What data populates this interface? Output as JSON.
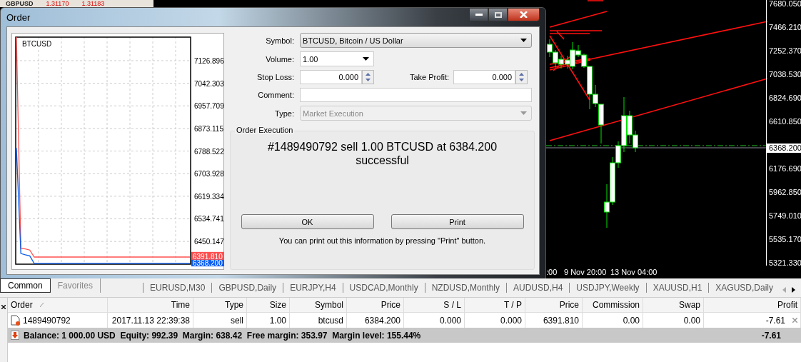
{
  "market_watch": {
    "symbol": "GBPUSD",
    "bid": "1.31170",
    "ask": "1.31183"
  },
  "window": {
    "title": "Order"
  },
  "tick_chart": {
    "chart_data": {
      "type": "line",
      "title": "BTCUSD",
      "grid": true,
      "categories": [
        null,
        null,
        null,
        null,
        null,
        null,
        null,
        null,
        null,
        null,
        null,
        null,
        null,
        null,
        null,
        null,
        null,
        null,
        null,
        null,
        null,
        null,
        null,
        null,
        null,
        null,
        null,
        null,
        null,
        null,
        null,
        null,
        null,
        null,
        null,
        null,
        null,
        null,
        null,
        null
      ],
      "ylim": [
        6365,
        7215
      ],
      "yticks": [
        {
          "value": 6450.147,
          "label": "6450.147"
        },
        {
          "value": 6534.741,
          "label": "6534.741"
        },
        {
          "value": 6619.334,
          "label": "6619.334"
        },
        {
          "value": 6703.928,
          "label": "6703.928"
        },
        {
          "value": 6788.522,
          "label": "6788.522"
        },
        {
          "value": 6873.115,
          "label": "6873.115"
        },
        {
          "value": 6957.709,
          "label": "6957.709"
        },
        {
          "value": 7042.303,
          "label": "7042.303"
        },
        {
          "value": 7126.896,
          "label": "7126.896"
        }
      ],
      "series": [
        {
          "color": "#ff5050",
          "values": [
            7215,
            6425,
            6422,
            6418,
            6391.81,
            6391.81,
            6391.81,
            6391.81,
            6391.81,
            6391.81,
            6391.81,
            6391.81,
            6391.81,
            6391.81,
            6391.81,
            6391.81,
            6391.81,
            6391.81,
            6391.81,
            6391.81,
            6391.81,
            6391.81,
            6391.81,
            6391.81,
            6391.81,
            6391.81,
            6391.81,
            6391.81,
            6391.81,
            6391.81,
            6391.81,
            6391.81,
            6391.81,
            6391.81,
            6391.81,
            6391.81,
            6391.81,
            6391.81,
            6391.81,
            6391.81
          ]
        },
        {
          "color": "#0a5cf0",
          "values": [
            6800,
            6405,
            6400,
            6396,
            6368.2,
            6368.2,
            6368.2,
            6368.2,
            6368.2,
            6368.2,
            6368.2,
            6368.2,
            6368.2,
            6368.2,
            6368.2,
            6368.2,
            6368.2,
            6368.2,
            6368.2,
            6368.2,
            6368.2,
            6368.2,
            6368.2,
            6368.2,
            6368.2,
            6368.2,
            6368.2,
            6368.2,
            6368.2,
            6368.2,
            6368.2,
            6368.2,
            6368.2,
            6368.2,
            6368.2,
            6368.2,
            6368.2,
            6368.2,
            6368.2,
            6368.2
          ]
        }
      ]
    },
    "ask_tag": "6391.810",
    "bid_tag": "6368.200"
  },
  "form": {
    "symbol": {
      "label": "Symbol:",
      "value": "BTCUSD, Bitcoin / US Dollar"
    },
    "volume": {
      "label": "Volume:",
      "value": "1.00"
    },
    "stop_loss": {
      "label": "Stop Loss:",
      "value": "0.000"
    },
    "take_profit": {
      "label": "Take Profit:",
      "value": "0.000"
    },
    "comment": {
      "label": "Comment:"
    },
    "type": {
      "label": "Type:",
      "value": "Market Execution",
      "disabled": true
    }
  },
  "execution": {
    "title": "Order Execution",
    "message": "#1489490792 sell 1.00 BTCUSD at 6384.200 successful",
    "buttons": [
      "OK",
      "Print"
    ],
    "note": "You can print out this information by pressing \"Print\" button."
  },
  "price_chart": {
    "price_labels": [
      "7680.050",
      "7466.210",
      "7252.370",
      "7038.530",
      "6824.690",
      "6610.850",
      "6176.690",
      "5962.850",
      "5749.010",
      "5535.170",
      "5321.330"
    ],
    "current_price": "6368.200",
    "time_labels": [
      ":00",
      "9 Nov 20:00",
      "13 Nov 04:00"
    ]
  },
  "terminal": {
    "view_tabs": [
      {
        "label": "Common",
        "selected": true
      },
      {
        "label": "Favorites",
        "selected": false
      }
    ],
    "chart_tabs": [
      {
        "label": "EURUSD,M30",
        "selected": false
      },
      {
        "label": "GBPUSD,Daily",
        "selected": false
      },
      {
        "label": "EURJPY,H4",
        "selected": false
      },
      {
        "label": "USDCAD,Monthly",
        "selected": false
      },
      {
        "label": "NZDUSD,Monthly",
        "selected": false
      },
      {
        "label": "AUDUSD,H4",
        "selected": false
      },
      {
        "label": "USDJPY,Weekly",
        "selected": false
      },
      {
        "label": "XAUUSD,H1",
        "selected": false
      },
      {
        "label": "XAGUSD,Daily",
        "selected": false
      }
    ],
    "scroll_left_disabled": true,
    "columns": [
      {
        "label": "Order",
        "sorted": true
      },
      {
        "label": "Time",
        "sorted": false
      },
      {
        "label": "Type",
        "sorted": false
      },
      {
        "label": "Size",
        "sorted": false
      },
      {
        "label": "Symbol",
        "sorted": false
      },
      {
        "label": "Price",
        "sorted": false
      },
      {
        "label": "S / L",
        "sorted": false
      },
      {
        "label": "T / P",
        "sorted": false
      },
      {
        "label": "Price",
        "sorted": false
      },
      {
        "label": "Commission",
        "sorted": false
      },
      {
        "label": "Swap",
        "sorted": false
      },
      {
        "label": "Profit",
        "sorted": false
      }
    ],
    "rows": [
      {
        "cells": [
          "1489490792",
          "2017.11.13 22:39:38",
          "sell",
          "1.00",
          "btcusd",
          "6384.200",
          "0.000",
          "0.000",
          "6391.810",
          "0.00",
          "0.00",
          "-7.61"
        ]
      }
    ],
    "summary": {
      "text": "Balance: 1 000.00 USD  Equity: 992.39  Margin: 638.42  Free margin: 353.97  Margin level: 155.44%",
      "profit": "-7.61"
    }
  }
}
